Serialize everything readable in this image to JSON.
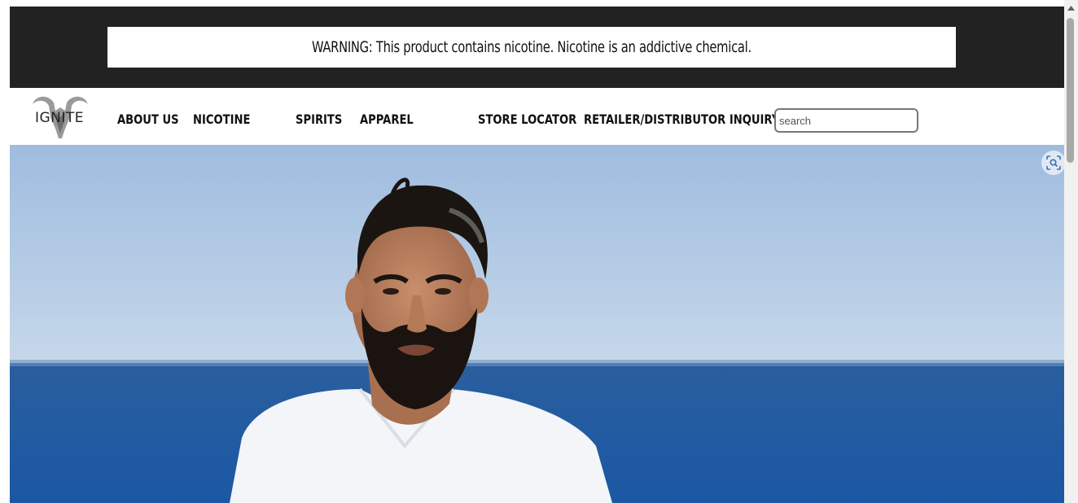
{
  "warning": {
    "text": "WARNING: This product contains nicotine. Nicotine is an addictive chemical."
  },
  "header": {
    "logo_text": "IGNITE",
    "nav": [
      {
        "label": "ABOUT US"
      },
      {
        "label": "NICOTINE"
      },
      {
        "label": "SPIRITS"
      },
      {
        "label": "APPAREL"
      },
      {
        "label": "STORE LOCATOR"
      },
      {
        "label": "RETAILER/DISTRIBUTOR INQUIRY"
      }
    ],
    "search": {
      "placeholder": "search",
      "value": ""
    }
  },
  "hero": {
    "image": "bearded-man-white-tshirt-ocean-photo"
  },
  "overlay": {
    "icon": "visual-search-icon"
  },
  "colors": {
    "warning_bar": "#222222",
    "sky": "#a9c4e2",
    "sea": "#1f5fa8"
  }
}
